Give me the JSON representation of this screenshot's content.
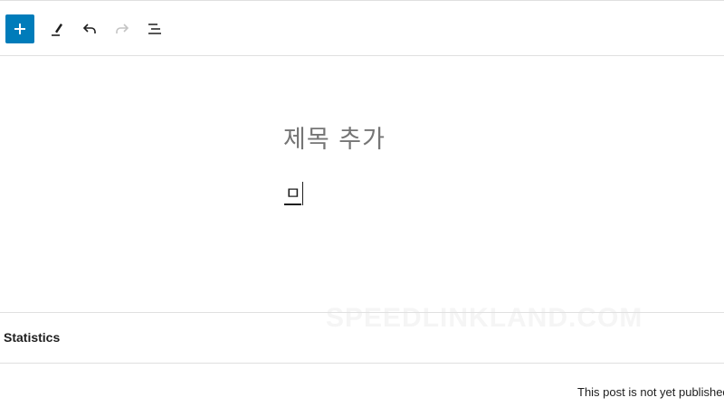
{
  "toolbar": {
    "add_block": "add-block",
    "tools": "edit-tools",
    "undo": "undo",
    "redo": "redo",
    "outline": "document-outline"
  },
  "editor": {
    "title_placeholder": "제목 추가",
    "paragraph_text": "ㅁ"
  },
  "watermark": "SPEEDLINKLAND.COM",
  "statistics_panel": {
    "title": "Statistics",
    "note": "This post is not yet published"
  },
  "colors": {
    "accent": "#007cba",
    "placeholder": "#757575",
    "divider": "#e0e0e0",
    "disabled_icon": "#c4c4c4"
  },
  "icons": {
    "add": "plus-icon",
    "tools": "pencil-icon",
    "undo": "undo-arrow-icon",
    "redo": "redo-arrow-icon",
    "outline": "list-view-icon"
  }
}
